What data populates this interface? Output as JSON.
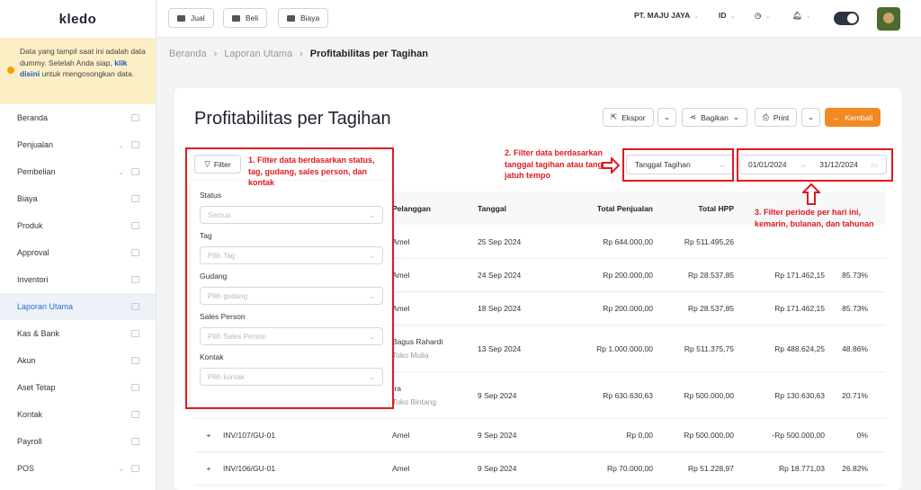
{
  "app": {
    "logo": "kledo"
  },
  "notice": {
    "text_before": "Data yang tampil saat ini adalah data dummy. Setelah Anda siap,",
    "link": "klik disini",
    "text_after": " untuk mengosongkan data."
  },
  "sidebar": {
    "items": [
      {
        "label": "Beranda",
        "caret": false
      },
      {
        "label": "Penjualan",
        "caret": true
      },
      {
        "label": "Pembelian",
        "caret": true
      },
      {
        "label": "Biaya",
        "caret": false
      },
      {
        "label": "Produk",
        "caret": false
      },
      {
        "label": "Approval",
        "caret": false
      },
      {
        "label": "Inventori",
        "caret": false
      },
      {
        "label": "Laporan Utama",
        "caret": false,
        "active": true
      },
      {
        "label": "Kas & Bank",
        "caret": false
      },
      {
        "label": "Akun",
        "caret": false
      },
      {
        "label": "Aset Tetap",
        "caret": false
      },
      {
        "label": "Kontak",
        "caret": false
      },
      {
        "label": "Payroll",
        "caret": false
      },
      {
        "label": "POS",
        "caret": true
      }
    ]
  },
  "topbar": {
    "jual": "Jual",
    "beli": "Beli",
    "biaya": "Biaya",
    "company": "PT. MAJU JAYA",
    "lang": "ID"
  },
  "breadcrumb": {
    "home": "Beranda",
    "parent": "Laporan Utama",
    "current": "Profitabilitas per Tagihan"
  },
  "page": {
    "title": "Profitabilitas per Tagihan"
  },
  "actions": {
    "export": "Ekspor",
    "share": "Bagikan",
    "print": "Print",
    "back": "Kembali"
  },
  "filter": {
    "button": "Filter",
    "date_type": "Tanggal Tagihan",
    "date_from": "01/01/2024",
    "date_to": "31/12/2024"
  },
  "dropdown": {
    "status_label": "Status",
    "status_value": "Semua",
    "tag_label": "Tag",
    "tag_placeholder": "Pilih Tag",
    "gudang_label": "Gudang",
    "gudang_placeholder": "Pilih gudang",
    "sales_label": "Sales Person",
    "sales_placeholder": "Pilih Sales Person",
    "kontak_label": "Kontak",
    "kontak_placeholder": "Pilih kontak"
  },
  "table": {
    "headers": {
      "pelanggan": "Pelanggan",
      "tanggal": "Tanggal",
      "penjualan": "Total Penjualan",
      "hpp": "Total HPP"
    },
    "rows": [
      {
        "nomor": "",
        "pelanggan": "Amel",
        "sub": "",
        "tanggal": "25 Sep 2024",
        "penjualan": "Rp 644.000,00",
        "hpp": "Rp 511.495,26",
        "laba": "",
        "persen": ""
      },
      {
        "nomor": "",
        "pelanggan": "Amel",
        "sub": "",
        "tanggal": "24 Sep 2024",
        "penjualan": "Rp 200.000,00",
        "hpp": "Rp 28.537,85",
        "laba": "Rp 171.462,15",
        "persen": "85.73%"
      },
      {
        "nomor": "",
        "pelanggan": "Amel",
        "sub": "",
        "tanggal": "18 Sep 2024",
        "penjualan": "Rp 200.000,00",
        "hpp": "Rp 28.537,85",
        "laba": "Rp 171.462,15",
        "persen": "85.73%"
      },
      {
        "nomor": "",
        "pelanggan": "Bagus Rahardi",
        "sub": "Toko Mulia",
        "tanggal": "13 Sep 2024",
        "penjualan": "Rp 1.000.000,00",
        "hpp": "Rp 511.375,75",
        "laba": "Rp 488.624,25",
        "persen": "48.86%"
      },
      {
        "nomor": "",
        "pelanggan": "Ira",
        "sub": "Toko Bintang",
        "tanggal": "9 Sep 2024",
        "penjualan": "Rp 630.630,63",
        "hpp": "Rp 500.000,00",
        "laba": "Rp 130.630,63",
        "persen": "20.71%"
      },
      {
        "nomor": "INV/107/GU-01",
        "pelanggan": "Amel",
        "sub": "",
        "tanggal": "9 Sep 2024",
        "penjualan": "Rp 0,00",
        "hpp": "Rp 500.000,00",
        "laba": "-Rp 500.000,00",
        "persen": "0%"
      },
      {
        "nomor": "INV/106/GU-01",
        "pelanggan": "Amel",
        "sub": "",
        "tanggal": "9 Sep 2024",
        "penjualan": "Rp 70.000,00",
        "hpp": "Rp 51.228,97",
        "laba": "Rp 18.771,03",
        "persen": "26.82%"
      }
    ]
  },
  "annotations": {
    "a1": "1. Filter data berdasarkan status, tag, gudang, sales person, dan kontak",
    "a2": "2. Filter data berdasarkan tanggal tagihan atau tanggal jatuh tempo",
    "a3": "3. Filter periode per hari ini, kemarin, bulanan, dan tahunan"
  },
  "colors": {
    "accent": "#2c6bd6",
    "orange": "#f28a22",
    "annotation_red": "#e0191f",
    "notice_bg": "#fcefc6"
  }
}
